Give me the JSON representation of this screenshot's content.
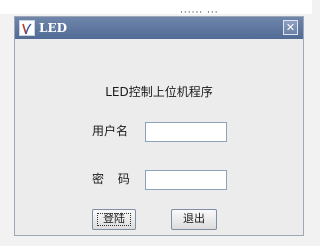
{
  "window": {
    "title": "LED"
  },
  "icons": {
    "app": "app-logo-icon",
    "close": "close-icon"
  },
  "heading": "LED控制上位机程序",
  "username": {
    "label": "用户名",
    "value": ""
  },
  "password": {
    "label": "密 码",
    "value": ""
  },
  "buttons": {
    "login": "登陆",
    "exit": "退出"
  },
  "background": {
    "partial_text": "······ ···"
  },
  "colors": {
    "titlebar": "#5f779f",
    "window_bg": "#ececec",
    "field_border": "#8fa2bd"
  }
}
